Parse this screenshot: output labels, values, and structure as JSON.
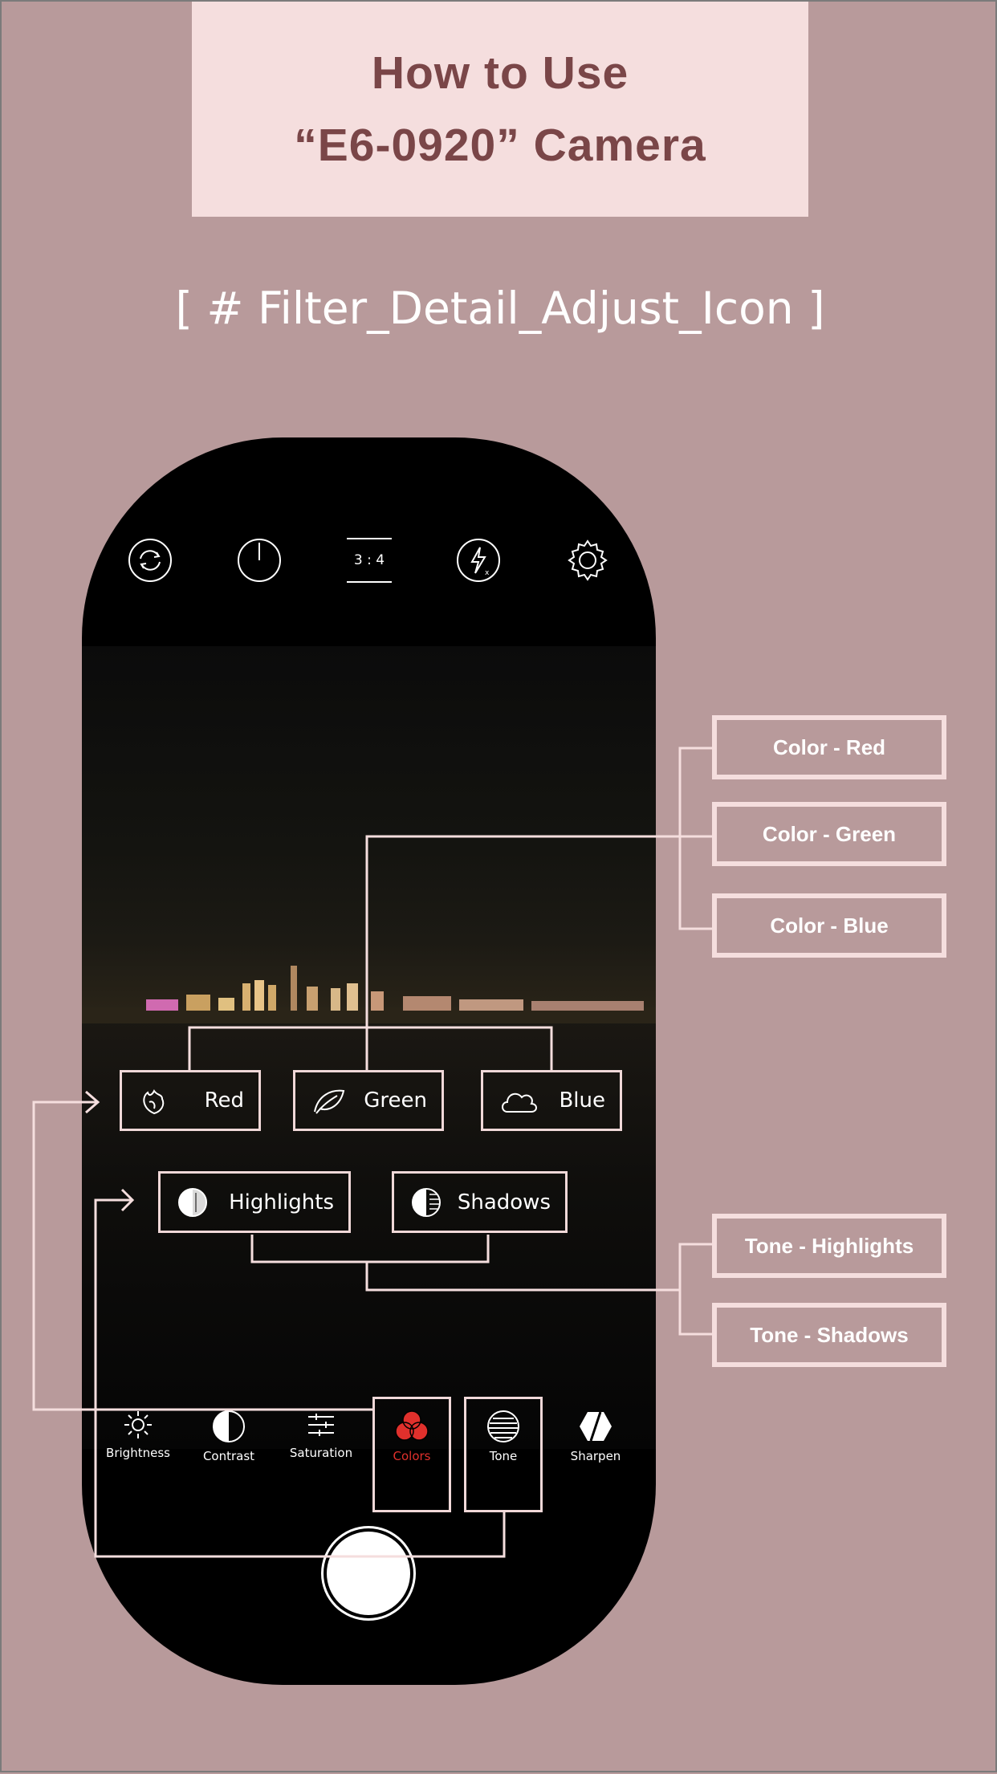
{
  "header": {
    "title_line1": "How to Use",
    "title_line2": "“E6-0920” Camera",
    "subtitle": "[ # Filter_Detail_Adjust_Icon ]"
  },
  "top_bar": {
    "icons": [
      "rotate-camera-icon",
      "timer-icon",
      "aspect-ratio-icon",
      "flash-off-icon",
      "settings-icon"
    ],
    "aspect_ratio_label": "3 : 4",
    "flash_label": "x"
  },
  "color_buttons": [
    {
      "label": "Red",
      "icon": "red-rose-icon"
    },
    {
      "label": "Green",
      "icon": "leaf-icon"
    },
    {
      "label": "Blue",
      "icon": "cloud-icon"
    }
  ],
  "tone_buttons": [
    {
      "label": "Highlights",
      "icon": "highlights-icon"
    },
    {
      "label": "Shadows",
      "icon": "shadows-icon"
    }
  ],
  "tools": [
    {
      "label": "Brightness",
      "icon": "sun-icon"
    },
    {
      "label": "Contrast",
      "icon": "contrast-icon"
    },
    {
      "label": "Saturation",
      "icon": "sliders-icon"
    },
    {
      "label": "Colors",
      "icon": "colors-icon",
      "active": true
    },
    {
      "label": "Tone",
      "icon": "tone-icon"
    },
    {
      "label": "Sharpen",
      "icon": "sharpen-icon"
    }
  ],
  "legend": {
    "color_red": "Color - Red",
    "color_green": "Color - Green",
    "color_blue": "Color - Blue",
    "tone_highlights": "Tone - Highlights",
    "tone_shadows": "Tone - Shadows"
  },
  "colors": {
    "background": "#b89a9b",
    "title_card": "#f5dede",
    "title_text": "#7a4648",
    "active_tool": "#e0302c",
    "outline": "#f0d8d8"
  }
}
